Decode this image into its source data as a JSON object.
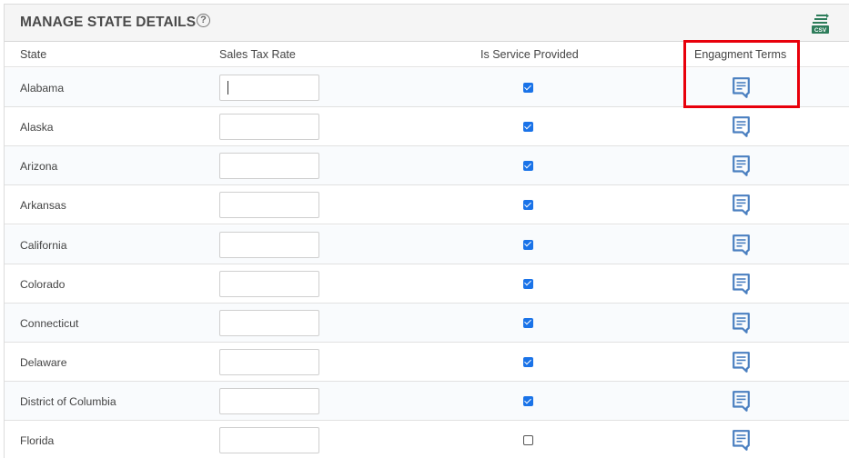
{
  "panel": {
    "title": "MANAGE STATE DETAILS",
    "help_icon": "question-circle-icon",
    "export_icon": "csv-export-icon",
    "export_icon_text": "CSV"
  },
  "columns": {
    "state": "State",
    "sales_tax_rate": "Sales Tax Rate",
    "is_service_provided": "Is Service Provided",
    "engagement_terms": "Engagment Terms"
  },
  "rows": [
    {
      "state": "Alabama",
      "sales_tax_rate": "",
      "service_provided": true
    },
    {
      "state": "Alaska",
      "sales_tax_rate": "",
      "service_provided": true
    },
    {
      "state": "Arizona",
      "sales_tax_rate": "",
      "service_provided": true
    },
    {
      "state": "Arkansas",
      "sales_tax_rate": "",
      "service_provided": true
    },
    {
      "state": "California",
      "sales_tax_rate": "",
      "service_provided": true
    },
    {
      "state": "Colorado",
      "sales_tax_rate": "",
      "service_provided": true
    },
    {
      "state": "Connecticut",
      "sales_tax_rate": "",
      "service_provided": true
    },
    {
      "state": "Delaware",
      "sales_tax_rate": "",
      "service_provided": true
    },
    {
      "state": "District of Columbia",
      "sales_tax_rate": "",
      "service_provided": true
    },
    {
      "state": "Florida",
      "sales_tax_rate": "",
      "service_provided": false
    }
  ],
  "engagement_terms_icon": "document-icon",
  "colors": {
    "accent": "#1a73e8",
    "doc_icon": "#4a7fc0",
    "csv_icon": "#2e7d5b",
    "highlight": "#e8000b"
  }
}
